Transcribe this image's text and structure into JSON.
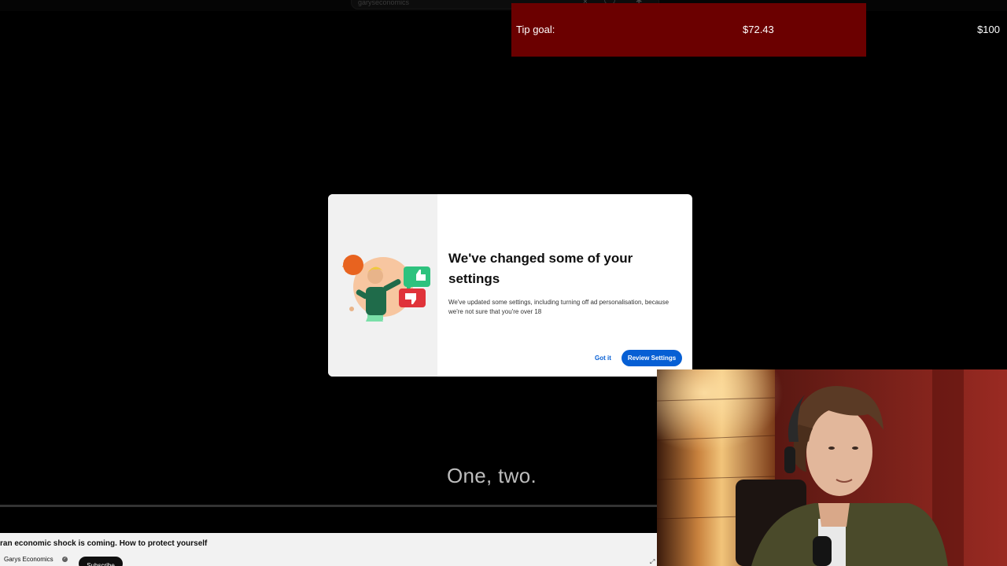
{
  "browser": {
    "search_text": "garyseconomics",
    "close_glyph": "×",
    "icons": [
      "close-icon",
      "mic-icon",
      "gear-icon"
    ]
  },
  "tip_goal": {
    "label": "Tip goal:",
    "current": "$72.43",
    "target": "$100",
    "background_color": "#6b0000"
  },
  "dialog": {
    "title": "We've changed some of your settings",
    "body": "We've updated some settings, including turning off ad personalisation, because we're not sure that you're over 18",
    "got_it_label": "Got it",
    "review_label": "Review Settings",
    "accent_color": "#065fd4"
  },
  "player": {
    "subtitle": "One, two."
  },
  "video": {
    "title": "ran economic shock is coming. How to protect yourself",
    "channel": "Garys Economics",
    "verified_glyph": "✓",
    "subscribe_label": "Subscribe"
  }
}
